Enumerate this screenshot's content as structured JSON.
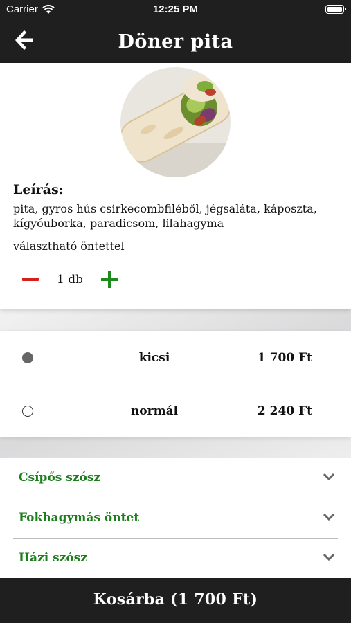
{
  "status_bar": {
    "carrier": "Carrier",
    "time": "12:25 PM"
  },
  "nav": {
    "title": "Döner pita",
    "back_icon": "arrow-left-icon"
  },
  "product": {
    "image_icon": "wrap-food-photo",
    "description_title": "Leírás:",
    "description": "pita, gyros hús csirkecombfiléből, jégsaláta, káposzta, kígyóuborka, paradicsom, lilahagyma",
    "extra": "választható öntettel",
    "quantity": "1 db"
  },
  "sizes": [
    {
      "name": "kicsi",
      "price": "1 700 Ft",
      "selected": true
    },
    {
      "name": "normál",
      "price": "2 240 Ft",
      "selected": false
    }
  ],
  "sauces": [
    {
      "label": "Csípős szósz"
    },
    {
      "label": "Fokhagymás öntet"
    },
    {
      "label": "Házi szósz"
    }
  ],
  "cart": {
    "label": "Kosárba (1 700 Ft)"
  },
  "colors": {
    "header": "#1f1f1f",
    "minus": "#d81d1d",
    "plus": "#1d8a1d",
    "sauce_text": "#1d7d1d"
  }
}
